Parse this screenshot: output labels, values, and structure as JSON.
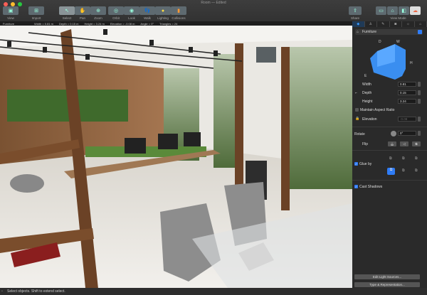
{
  "window": {
    "title": "Room — Edited"
  },
  "toolbar": {
    "items": [
      {
        "label": "View",
        "icon": "view-icon"
      },
      {
        "label": "Import",
        "icon": "import-icon"
      },
      {
        "label": "Select",
        "icon": "cursor-icon"
      },
      {
        "label": "Pan",
        "icon": "hand-icon"
      },
      {
        "label": "Zoom",
        "icon": "zoom-icon"
      },
      {
        "label": "Orbit",
        "icon": "orbit-icon"
      },
      {
        "label": "Look",
        "icon": "eye-icon"
      },
      {
        "label": "Walk",
        "icon": "footprints-icon"
      },
      {
        "label": "Lighting",
        "icon": "bulb-icon"
      },
      {
        "label": "Collisions",
        "icon": "collision-icon"
      }
    ],
    "share": "Share",
    "view_mode": "View Mode"
  },
  "infobar": {
    "name": "Furniture",
    "width": "Width = 0.81 m",
    "depth": "Depth = 0.15 m",
    "height": "Height = 3.24 m",
    "elevation": "Elevation = -0.08 m",
    "angle": "Angle = 0°",
    "triangles": "Triangles = 24"
  },
  "sidebar": {
    "category": "Furniture",
    "dims": {
      "d": "D",
      "w": "W",
      "h": "H",
      "e": "E"
    },
    "width_label": "Width",
    "width": "0.81",
    "depth_label": "Depth",
    "depth": "0.15",
    "height_label": "Height",
    "height": "3.24",
    "aspect": "Maintain Aspect Ratio",
    "elevation_label": "Elevation",
    "elevation": "-0.08",
    "rotate_label": "Rotate",
    "rotate": "0°",
    "flip_label": "Flip",
    "glue_label": "Glue by",
    "shadows_label": "Cast Shadows",
    "edit_lights": "Edit Light Sources...",
    "type_rep": "Type & Representation..."
  },
  "status": {
    "text": "Select objects. Shift to extend select."
  }
}
